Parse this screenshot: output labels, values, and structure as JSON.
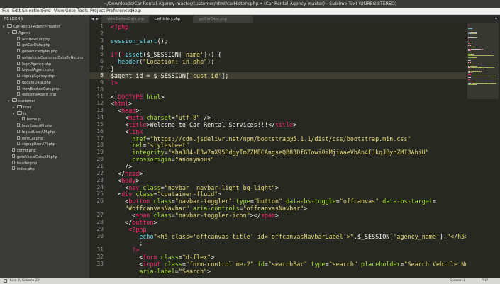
{
  "window": {
    "title": "~/Downloads/Car-Rental-Agency-master/customer/html/carHistory.php • (Car-Rental-Agency-master) - Sublime Text (UNREGISTERED)"
  },
  "menu": [
    "File",
    "Edit",
    "Selection",
    "Find",
    "View",
    "Goto",
    "Tools",
    "Project",
    "Preferences",
    "Help"
  ],
  "sidebar": {
    "header": "FOLDERS",
    "items": [
      {
        "label": "Car-Rental-Agency-master",
        "type": "folder",
        "depth": 0,
        "expanded": true
      },
      {
        "label": "Agents",
        "type": "folder",
        "depth": 1,
        "expanded": true
      },
      {
        "label": "addNewCar.php",
        "type": "file",
        "depth": 2
      },
      {
        "label": "getCarData.php",
        "type": "file",
        "depth": 2
      },
      {
        "label": "getVehicleByNo.php",
        "type": "file",
        "depth": 2
      },
      {
        "label": "getVehicleCustomerDataByNo.php",
        "type": "file",
        "depth": 2
      },
      {
        "label": "loginAgency.php",
        "type": "file",
        "depth": 2
      },
      {
        "label": "logoutAgency.php",
        "type": "file",
        "depth": 2
      },
      {
        "label": "signupAgency.php",
        "type": "file",
        "depth": 2
      },
      {
        "label": "updateData.php",
        "type": "file",
        "depth": 2
      },
      {
        "label": "viewBookedCars.php",
        "type": "file",
        "depth": 2
      },
      {
        "label": "welcomeAgent.php",
        "type": "file",
        "depth": 2
      },
      {
        "label": "customer",
        "type": "folder",
        "depth": 1,
        "expanded": true
      },
      {
        "label": "html",
        "type": "folder",
        "depth": 2,
        "expanded": false
      },
      {
        "label": "js",
        "type": "folder",
        "depth": 2,
        "expanded": true
      },
      {
        "label": "home.js",
        "type": "file",
        "depth": 3
      },
      {
        "label": "loginUserAPI.php",
        "type": "file",
        "depth": 2
      },
      {
        "label": "logoutUserAPI.php",
        "type": "file",
        "depth": 2
      },
      {
        "label": "rentCar.php",
        "type": "file",
        "depth": 2
      },
      {
        "label": "signupUserAPI.php",
        "type": "file",
        "depth": 2
      },
      {
        "label": "config.php",
        "type": "file",
        "depth": 1
      },
      {
        "label": "getVehicleDataAPI.php",
        "type": "file",
        "depth": 1
      },
      {
        "label": "header.php",
        "type": "file",
        "depth": 1
      },
      {
        "label": "index.php",
        "type": "file",
        "depth": 1
      }
    ]
  },
  "tabs": [
    {
      "label": "viewBookedCars.php",
      "active": false
    },
    {
      "label": "carHistory.php",
      "active": true
    },
    {
      "label": "getCarData.php",
      "active": false
    }
  ],
  "tab_nav": {
    "left": "◀",
    "right": "▶",
    "close": "×",
    "menu": "▾"
  },
  "editor": {
    "current_line": "8",
    "lines": [
      {
        "n": "1",
        "tokens": [
          [
            "<?php",
            "#f92672"
          ]
        ]
      },
      {
        "n": "2",
        "tokens": []
      },
      {
        "n": "3",
        "tokens": [
          [
            "session_start",
            "#66d9ef"
          ],
          [
            "();",
            "#f8f8f2"
          ]
        ]
      },
      {
        "n": "4",
        "tokens": []
      },
      {
        "n": "5",
        "tokens": [
          [
            "if",
            "#f92672"
          ],
          [
            "(",
            "#f8f8f2"
          ],
          [
            "!",
            "#f92672"
          ],
          [
            "isset",
            "#66d9ef"
          ],
          [
            "($_SESSION[",
            "#f8f8f2"
          ],
          [
            "'name'",
            "#e6db74"
          ],
          [
            "])) {",
            "#f8f8f2"
          ]
        ]
      },
      {
        "n": "6",
        "tokens": [
          [
            "  header",
            "#66d9ef"
          ],
          [
            "(",
            "#f8f8f2"
          ],
          [
            "\"Location: in.php\"",
            "#e6db74"
          ],
          [
            ");",
            "#f8f8f2"
          ]
        ]
      },
      {
        "n": "7",
        "tokens": [
          [
            "}",
            "#f8f8f2"
          ]
        ]
      },
      {
        "n": "8",
        "tokens": [
          [
            "$agent_id = $_SESSION[",
            "#f8f8f2"
          ],
          [
            "'cust_id'",
            "#e6db74"
          ],
          [
            "];",
            "#f8f8f2"
          ]
        ]
      },
      {
        "n": "9",
        "tokens": [
          [
            "?>",
            "#f92672"
          ]
        ]
      },
      {
        "n": "10",
        "tokens": []
      },
      {
        "n": "11",
        "tokens": [
          [
            "<!",
            "#f8f8f2"
          ],
          [
            "DOCTYPE",
            "#f92672"
          ],
          [
            " html",
            "#a6e22e"
          ],
          [
            ">",
            "#f8f8f2"
          ]
        ]
      },
      {
        "n": "12",
        "tokens": [
          [
            "<",
            "#f8f8f2"
          ],
          [
            "html",
            "#f92672"
          ],
          [
            ">",
            "#f8f8f2"
          ]
        ]
      },
      {
        "n": "13",
        "tokens": [
          [
            "  <",
            "#f8f8f2"
          ],
          [
            "head",
            "#f92672"
          ],
          [
            ">",
            "#f8f8f2"
          ]
        ]
      },
      {
        "n": "14",
        "tokens": [
          [
            "    <",
            "#f8f8f2"
          ],
          [
            "meta",
            "#f92672"
          ],
          [
            " charset",
            "#a6e22e"
          ],
          [
            "=",
            "#f8f8f2"
          ],
          [
            "\"utf-8\"",
            "#e6db74"
          ],
          [
            " />",
            "#f8f8f2"
          ]
        ]
      },
      {
        "n": "15",
        "tokens": [
          [
            "    <",
            "#f8f8f2"
          ],
          [
            "title",
            "#f92672"
          ],
          [
            ">Welcome to Car Rental Services!!!</",
            "#f8f8f2"
          ],
          [
            "title",
            "#f92672"
          ],
          [
            ">",
            "#f8f8f2"
          ]
        ]
      },
      {
        "n": "16",
        "tokens": [
          [
            "    <",
            "#f8f8f2"
          ],
          [
            "link",
            "#f92672"
          ]
        ]
      },
      {
        "n": "17",
        "tokens": [
          [
            "      href",
            "#a6e22e"
          ],
          [
            "=",
            "#f8f8f2"
          ],
          [
            "\"https://cdn.jsdelivr.net/npm/bootstrap@5.1.1/dist/css/bootstrap.min.css\"",
            "#e6db74"
          ]
        ]
      },
      {
        "n": "18",
        "tokens": [
          [
            "      rel",
            "#a6e22e"
          ],
          [
            "=",
            "#f8f8f2"
          ],
          [
            "\"stylesheet\"",
            "#e6db74"
          ]
        ]
      },
      {
        "n": "19",
        "tokens": [
          [
            "      integrity",
            "#a6e22e"
          ],
          [
            "=",
            "#f8f8f2"
          ],
          [
            "\"sha384-F3w7mX95PdgyTmZZMECAngseQB83DfGTowi0iMjiWaeVhAn4FJkqJByhZMI3AhiU\"",
            "#e6db74"
          ]
        ]
      },
      {
        "n": "20",
        "tokens": [
          [
            "      crossorigin",
            "#a6e22e"
          ],
          [
            "=",
            "#f8f8f2"
          ],
          [
            "\"anonymous\"",
            "#e6db74"
          ]
        ]
      },
      {
        "n": "21",
        "tokens": [
          [
            "    />",
            "#f8f8f2"
          ]
        ]
      },
      {
        "n": "22",
        "tokens": [
          [
            "  </",
            "#f8f8f2"
          ],
          [
            "head",
            "#f92672"
          ],
          [
            ">",
            "#f8f8f2"
          ]
        ]
      },
      {
        "n": "23",
        "tokens": [
          [
            "  <",
            "#f8f8f2"
          ],
          [
            "body",
            "#f92672"
          ],
          [
            ">",
            "#f8f8f2"
          ]
        ]
      },
      {
        "n": "24",
        "tokens": [
          [
            "    <",
            "#f8f8f2"
          ],
          [
            "nav",
            "#f92672"
          ],
          [
            " class",
            "#a6e22e"
          ],
          [
            "=",
            "#f8f8f2"
          ],
          [
            "\"navbar  navbar-light bg-light\"",
            "#e6db74"
          ],
          [
            ">",
            "#f8f8f2"
          ]
        ]
      },
      {
        "n": "25",
        "tokens": [
          [
            "  <",
            "#f8f8f2"
          ],
          [
            "div",
            "#f92672"
          ],
          [
            " class",
            "#a6e22e"
          ],
          [
            "=",
            "#f8f8f2"
          ],
          [
            "\"container-fluid\"",
            "#e6db74"
          ],
          [
            ">",
            "#f8f8f2"
          ]
        ]
      },
      {
        "n": "26",
        "tokens": [
          [
            "    <",
            "#f8f8f2"
          ],
          [
            "button",
            "#f92672"
          ],
          [
            " class",
            "#a6e22e"
          ],
          [
            "=",
            "#f8f8f2"
          ],
          [
            "\"navbar-toggler\"",
            "#e6db74"
          ],
          [
            " type",
            "#a6e22e"
          ],
          [
            "=",
            "#f8f8f2"
          ],
          [
            "\"button\"",
            "#e6db74"
          ],
          [
            " data-bs-toggle",
            "#a6e22e"
          ],
          [
            "=",
            "#f8f8f2"
          ],
          [
            "\"offcanvas\"",
            "#e6db74"
          ],
          [
            " data-bs-target",
            "#a6e22e"
          ],
          [
            "=",
            "#f8f8f2"
          ]
        ]
      },
      {
        "n": "",
        "tokens": [
          [
            "    \"#offcanvasNavbar\"",
            "#e6db74"
          ],
          [
            " aria-controls",
            "#a6e22e"
          ],
          [
            "=",
            "#f8f8f2"
          ],
          [
            "\"offcanvasNavbar\"",
            "#e6db74"
          ],
          [
            ">",
            "#f8f8f2"
          ]
        ]
      },
      {
        "n": "27",
        "tokens": [
          [
            "      <",
            "#f8f8f2"
          ],
          [
            "span",
            "#f92672"
          ],
          [
            " class",
            "#a6e22e"
          ],
          [
            "=",
            "#f8f8f2"
          ],
          [
            "\"navbar-toggler-icon\"",
            "#e6db74"
          ],
          [
            "></",
            "#f8f8f2"
          ],
          [
            "span",
            "#f92672"
          ],
          [
            ">",
            "#f8f8f2"
          ]
        ]
      },
      {
        "n": "28",
        "tokens": [
          [
            "    </",
            "#f8f8f2"
          ],
          [
            "button",
            "#f92672"
          ],
          [
            ">",
            "#f8f8f2"
          ]
        ]
      },
      {
        "n": "29",
        "tokens": [
          [
            "     <?php",
            "#f92672"
          ]
        ]
      },
      {
        "n": "30",
        "tokens": [
          [
            "        echo",
            "#66d9ef"
          ],
          [
            "\"<h5 class='offcanvas-title' id='offcanvasNavbarLabel'>\"",
            "#e6db74"
          ],
          [
            ".$_SESSION[",
            "#f8f8f2"
          ],
          [
            "'agency_name'",
            "#e6db74"
          ],
          [
            "].",
            "#f8f8f2"
          ],
          [
            "\"</h5>\"",
            "#e6db74"
          ]
        ]
      },
      {
        "n": "",
        "tokens": [
          [
            "        ;",
            "#f8f8f2"
          ]
        ]
      },
      {
        "n": "31",
        "tokens": [
          [
            "      ?>",
            "#f92672"
          ]
        ]
      },
      {
        "n": "32",
        "tokens": [
          [
            "        <",
            "#f8f8f2"
          ],
          [
            "form",
            "#f92672"
          ],
          [
            " class",
            "#a6e22e"
          ],
          [
            "=",
            "#f8f8f2"
          ],
          [
            "\"d-flex\"",
            "#e6db74"
          ],
          [
            ">",
            "#f8f8f2"
          ]
        ]
      },
      {
        "n": "33",
        "tokens": [
          [
            "        <",
            "#f8f8f2"
          ],
          [
            "input",
            "#f92672"
          ],
          [
            " class",
            "#a6e22e"
          ],
          [
            "=",
            "#f8f8f2"
          ],
          [
            "\"form-control me-2\"",
            "#e6db74"
          ],
          [
            " id",
            "#a6e22e"
          ],
          [
            "=",
            "#f8f8f2"
          ],
          [
            "\"searchBar\"",
            "#e6db74"
          ],
          [
            " type",
            "#a6e22e"
          ],
          [
            "=",
            "#f8f8f2"
          ],
          [
            "\"search\"",
            "#e6db74"
          ],
          [
            " placeholder",
            "#a6e22e"
          ],
          [
            "=",
            "#f8f8f2"
          ],
          [
            "\"Search Vehicle No\"",
            "#e6db74"
          ]
        ]
      },
      {
        "n": "",
        "tokens": [
          [
            "        aria-label",
            "#a6e22e"
          ],
          [
            "=",
            "#f8f8f2"
          ],
          [
            "\"Search\"",
            "#e6db74"
          ],
          [
            ">",
            "#f8f8f2"
          ]
        ]
      }
    ]
  },
  "status": {
    "position": "Line 8, Column 29",
    "spaces": "Spaces: 2",
    "syntax": "PHP"
  }
}
